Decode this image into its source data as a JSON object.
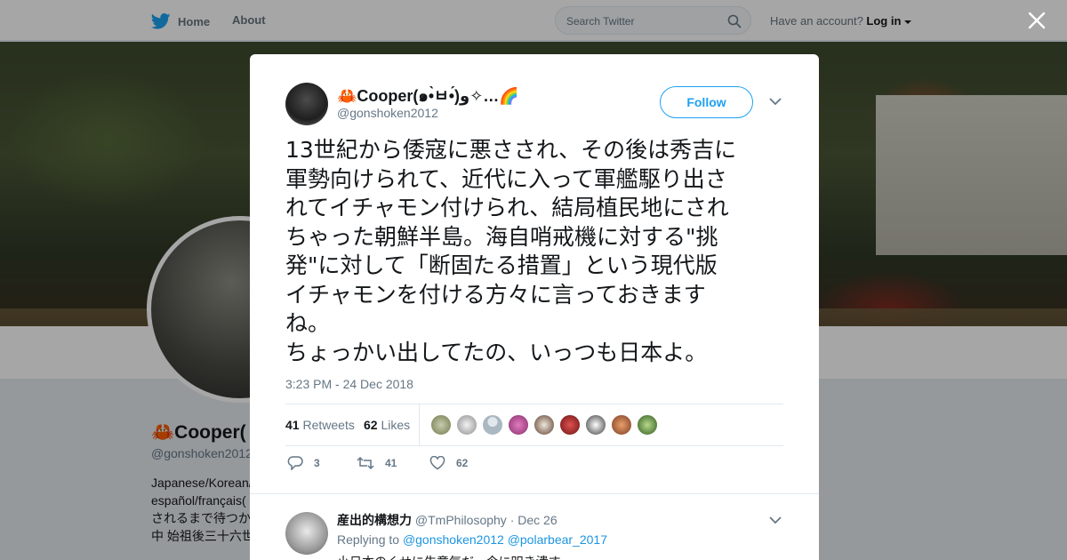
{
  "colors": {
    "brand": "#1da1f2",
    "link": "#1b95e0",
    "muted": "#657786"
  },
  "nav": {
    "home_label": "Home",
    "about_label": "About",
    "search_placeholder": "Search Twitter",
    "account_text": "Have an account?",
    "login_label": "Log in"
  },
  "profile": {
    "name": "🦀Cooper(",
    "handle": "@gonshoken2012",
    "bio_lines": [
      "Japanese/Korean/",
      "español/français(",
      "されるまで待つか",
      "中 始祖後三十六世"
    ]
  },
  "tweet": {
    "author_name": "🦀Cooper(๑•̀ㅂ•́)و✧…🌈",
    "author_handle": "@gonshoken2012",
    "follow_label": "Follow",
    "text_lines": [
      "13世紀から倭寇に悪さされ、その後は秀吉に",
      "軍勢向けられて、近代に入って軍艦駆り出さ",
      "れてイチャモン付けられ、結局植民地にされ",
      "ちゃった朝鮮半島。海自哨戒機に対する\"挑",
      "発\"に対して「断固たる措置」という現代版",
      "イチャモンを付ける方々に言っておきます",
      "ね。",
      "ちょっかい出してたの、いっつも日本よ。"
    ],
    "timestamp": "3:23 PM - 24 Dec 2018",
    "retweets_count": "41",
    "retweets_label": "Retweets",
    "likes_count": "62",
    "likes_label": "Likes",
    "reply_count": "3",
    "retweet_action_count": "41",
    "like_action_count": "62"
  },
  "reply": {
    "name": "産出的構想力",
    "handle": "@TmPhilosophy",
    "date": "· Dec 26",
    "replying_to_label": "Replying to",
    "mentions": [
      "@gonshoken2012",
      "@polarbear_2017"
    ],
    "text": "小日本のくせに生意気だ、今に叩き潰す"
  }
}
